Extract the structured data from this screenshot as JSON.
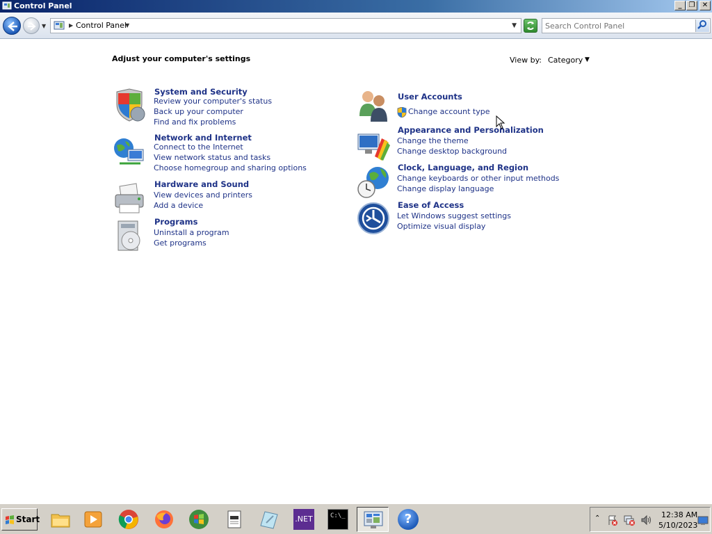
{
  "window": {
    "title": "Control Panel",
    "min_label": "_",
    "max_label": "❐",
    "close_label": "✕"
  },
  "address_bar": {
    "breadcrumb": "Control Panel",
    "search_placeholder": "Search Control Panel"
  },
  "content": {
    "heading": "Adjust your computer's settings",
    "view_by_label": "View by:",
    "view_by_value": "Category"
  },
  "categories": [
    {
      "title": "System and Security",
      "icon": "shield-icon",
      "links": [
        "Review your computer's status",
        "Back up your computer",
        "Find and fix problems"
      ]
    },
    {
      "title": "Network and Internet",
      "icon": "network-globe-icon",
      "links": [
        "Connect to the Internet",
        "View network status and tasks",
        "Choose homegroup and sharing options"
      ]
    },
    {
      "title": "Hardware and Sound",
      "icon": "printer-icon",
      "links": [
        "View devices and printers",
        "Add a device"
      ]
    },
    {
      "title": "Programs",
      "icon": "programs-icon",
      "links": [
        "Uninstall a program",
        "Get programs"
      ]
    },
    {
      "title": "User Accounts",
      "icon": "users-icon",
      "links": [
        "Change account type"
      ]
    },
    {
      "title": "Appearance and Personalization",
      "icon": "monitor-palette-icon",
      "links": [
        "Change the theme",
        "Change desktop background"
      ]
    },
    {
      "title": "Clock, Language, and Region",
      "icon": "clock-globe-icon",
      "links": [
        "Change keyboards or other input methods",
        "Change display language"
      ]
    },
    {
      "title": "Ease of Access",
      "icon": "ease-of-access-icon",
      "links": [
        "Let Windows suggest settings",
        "Optimize visual display"
      ]
    }
  ],
  "taskbar": {
    "start_label": "Start",
    "apps": [
      "file-explorer-icon",
      "media-player-icon",
      "chrome-icon",
      "firefox-icon",
      "windows-icon",
      "notepad-icon",
      "paint-icon",
      "dotnet-icon",
      "cmd-icon",
      "control-panel-icon",
      "help-icon"
    ],
    "dotnet_label": ".NET",
    "cmd_label": "C:\\_",
    "help_label": "?",
    "clock_time": "12:38 AM",
    "clock_date": "5/10/2023"
  }
}
